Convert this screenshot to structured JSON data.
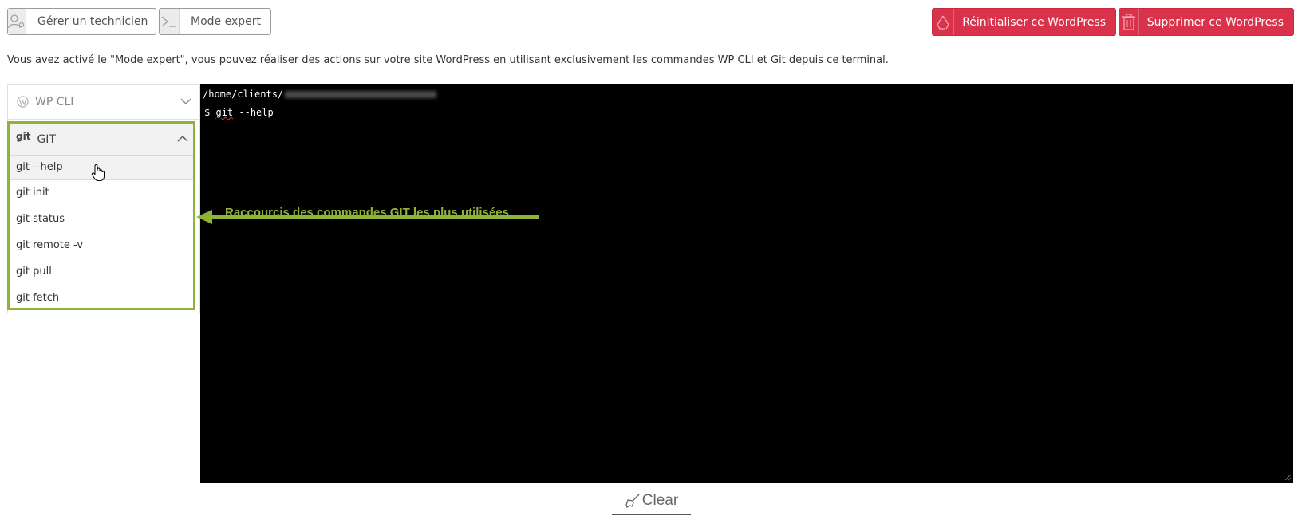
{
  "toolbar": {
    "manage_technician_label": "Gérer un technicien",
    "expert_mode_label": "Mode expert",
    "reset_label": "Réinitialiser ce WordPress",
    "delete_label": "Supprimer ce WordPress"
  },
  "info_text": "Vous avez activé le \"Mode expert\", vous pouvez réaliser des actions sur votre site WordPress en utilisant exclusivement les commandes WP CLI et Git depuis ce terminal.",
  "sidebar": {
    "wpcli_label": "WP CLI",
    "git_label": "GIT",
    "git_icon_text": "git",
    "git_commands": [
      "git --help",
      "git init",
      "git status",
      "git remote -v",
      "git pull",
      "git fetch"
    ]
  },
  "terminal": {
    "path": "/home/clients/",
    "prompt": "$",
    "command_part1": "git",
    "command_part2": " --help"
  },
  "annotation": {
    "text": "Raccourcis des commandes GIT les plus utilisées",
    "color": "#8fb339"
  },
  "clear_label": "Clear",
  "colors": {
    "danger": "#d9324a",
    "highlight": "#8fb339",
    "terminal_bg": "#000000"
  }
}
